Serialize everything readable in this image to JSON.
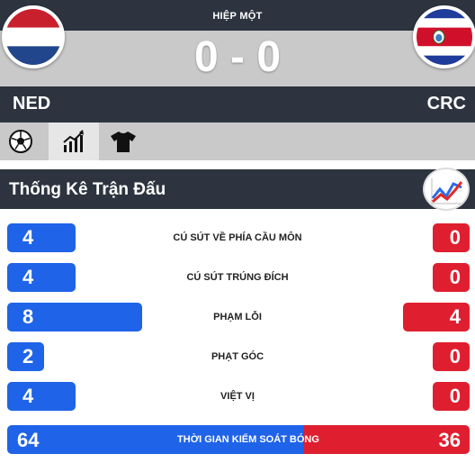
{
  "match": {
    "period": "HIỆP MỘT",
    "score": "0 - 0",
    "home_code": "NED",
    "away_code": "CRC",
    "home_flag": "netherlands-flag-icon",
    "away_flag": "costa-rica-flag-icon"
  },
  "tabs": [
    {
      "icon": "soccer-ball-icon",
      "active": false
    },
    {
      "icon": "bar-chart-icon",
      "active": true
    },
    {
      "icon": "jersey-icon",
      "active": false
    }
  ],
  "stats": {
    "title": "Thống Kê Trận Đấu",
    "logo_icon": "trend-chart-icon",
    "rows": [
      {
        "label": "CÚ SÚT VỀ PHÍA CẦU MÔN",
        "home": "4",
        "away": "0"
      },
      {
        "label": "CÚ SÚT TRÚNG ĐÍCH",
        "home": "4",
        "away": "0"
      },
      {
        "label": "PHẠM LỖI",
        "home": "8",
        "away": "4"
      },
      {
        "label": "PHẠT GÓC",
        "home": "2",
        "away": "0"
      },
      {
        "label": "VIỆT VỊ",
        "home": "4",
        "away": "0"
      }
    ],
    "possession": {
      "label": "THỜI GIAN KIỂM SOÁT BÓNG",
      "home": "64",
      "away": "36"
    }
  },
  "colors": {
    "dark_bar": "#2d3440",
    "grey_band": "#c9c9c9",
    "home_blue": "#1f63e8",
    "away_red": "#df1f2f"
  }
}
